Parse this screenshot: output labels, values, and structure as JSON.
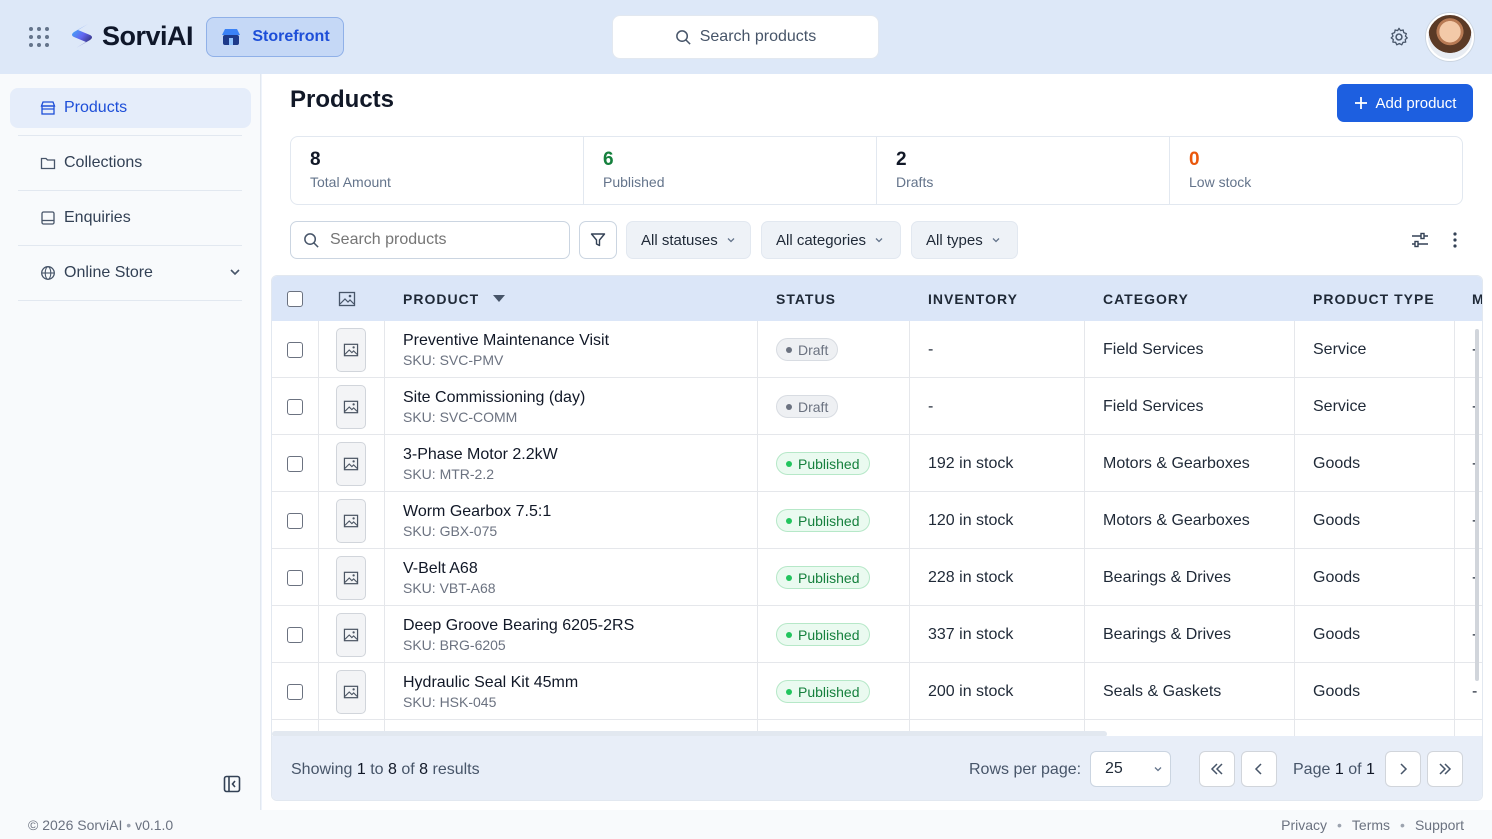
{
  "app": {
    "name": "SorviAI",
    "store_label": "Storefront",
    "search_placeholder": "Search products"
  },
  "colors": {
    "accent": "#1d5fe0",
    "published": "#15803d",
    "low_stock": "#ea580c"
  },
  "sidebar": {
    "items": [
      {
        "label": "Products",
        "icon": "store-icon",
        "active": true
      },
      {
        "label": "Collections",
        "icon": "folder-icon"
      },
      {
        "label": "Enquiries",
        "icon": "inbox-icon"
      },
      {
        "label": "Online Store",
        "icon": "globe-icon",
        "expandable": true
      }
    ]
  },
  "page": {
    "title": "Products",
    "add_label": "Add product"
  },
  "stats": [
    {
      "value": "8",
      "label": "Total Amount"
    },
    {
      "value": "6",
      "label": "Published"
    },
    {
      "value": "2",
      "label": "Drafts"
    },
    {
      "value": "0",
      "label": "Low stock"
    }
  ],
  "filters": {
    "search_placeholder": "Search products",
    "status": "All statuses",
    "category": "All categories",
    "type": "All types"
  },
  "table": {
    "columns": {
      "product": "PRODUCT",
      "status": "STATUS",
      "inventory": "INVENTORY",
      "category": "CATEGORY",
      "type": "PRODUCT TYPE",
      "more": "M"
    },
    "rows": [
      {
        "name": "Preventive Maintenance Visit",
        "sku": "SKU: SVC-PMV",
        "status": "Draft",
        "inventory": "-",
        "category": "Field Services",
        "type": "Service",
        "extra": "-"
      },
      {
        "name": "Site Commissioning (day)",
        "sku": "SKU: SVC-COMM",
        "status": "Draft",
        "inventory": "-",
        "category": "Field Services",
        "type": "Service",
        "extra": "-"
      },
      {
        "name": "3-Phase Motor 2.2kW",
        "sku": "SKU: MTR-2.2",
        "status": "Published",
        "inventory": "192 in stock",
        "category": "Motors & Gearboxes",
        "type": "Goods",
        "extra": "-"
      },
      {
        "name": "Worm Gearbox 7.5:1",
        "sku": "SKU: GBX-075",
        "status": "Published",
        "inventory": "120 in stock",
        "category": "Motors & Gearboxes",
        "type": "Goods",
        "extra": "-"
      },
      {
        "name": "V-Belt A68",
        "sku": "SKU: VBT-A68",
        "status": "Published",
        "inventory": "228 in stock",
        "category": "Bearings & Drives",
        "type": "Goods",
        "extra": "-"
      },
      {
        "name": "Deep Groove Bearing 6205-2RS",
        "sku": "SKU: BRG-6205",
        "status": "Published",
        "inventory": "337 in stock",
        "category": "Bearings & Drives",
        "type": "Goods",
        "extra": "-"
      },
      {
        "name": "Hydraulic Seal Kit 45mm",
        "sku": "SKU: HSK-045",
        "status": "Published",
        "inventory": "200 in stock",
        "category": "Seals & Gaskets",
        "type": "Goods",
        "extra": "-"
      }
    ]
  },
  "pagination": {
    "showing_prefix": "Showing",
    "from": "1",
    "to_word": "to",
    "to": "8",
    "of_word": "of",
    "total": "8",
    "suffix": "results",
    "rows_per_page_label": "Rows per page:",
    "rows_per_page": "25",
    "page_word": "Page",
    "page": "1",
    "page_of": "of",
    "pages": "1"
  },
  "footer": {
    "copyright": "© 2026 SorviAI",
    "version": "v0.1.0",
    "links": [
      "Privacy",
      "Terms",
      "Support"
    ]
  }
}
